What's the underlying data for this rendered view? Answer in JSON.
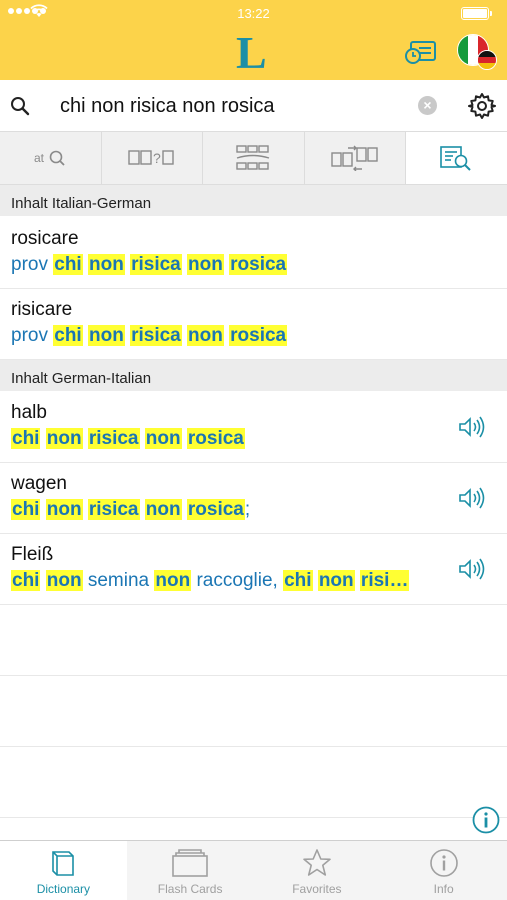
{
  "status_bar": {
    "time": "13:22",
    "battery_level": 1.0
  },
  "nav": {
    "logo_letter": "L",
    "source_language": "Italian",
    "target_language": "German"
  },
  "search": {
    "query": "chi non risica non rosica"
  },
  "mode_tabs": [
    {
      "icon": "text-search-icon",
      "label": "at"
    },
    {
      "icon": "fill-in-blank-icon",
      "label": "?"
    },
    {
      "icon": "conjugation-table-icon",
      "label": ""
    },
    {
      "icon": "phrase-compare-icon",
      "label": ""
    },
    {
      "icon": "full-text-search-icon",
      "label": "",
      "active": true
    }
  ],
  "sections": [
    {
      "title": "Inhalt Italian-German",
      "entries": [
        {
          "headword": "rosicare",
          "prefix": "prov",
          "translation": [
            "chi",
            "non",
            "risica",
            "non",
            "rosica"
          ],
          "suffix": "",
          "has_audio": false
        },
        {
          "headword": "risicare",
          "prefix": "prov",
          "translation": [
            "chi",
            "non",
            "risica",
            "non",
            "rosica"
          ],
          "suffix": "",
          "has_audio": false
        }
      ]
    },
    {
      "title": "Inhalt German-Italian",
      "entries": [
        {
          "headword": "halb",
          "prefix": "",
          "translation": [
            "chi",
            "non",
            "risica",
            "non",
            "rosica"
          ],
          "suffix": "",
          "has_audio": true
        },
        {
          "headword": "wagen",
          "prefix": "",
          "translation": [
            "chi",
            "non",
            "risica",
            "non",
            "rosica"
          ],
          "suffix": ";",
          "has_audio": true
        },
        {
          "headword": "Fleiß",
          "prefix": "",
          "translation_mixed": [
            {
              "t": "chi",
              "hl": true
            },
            {
              "t": " ",
              "hl": false
            },
            {
              "t": "non",
              "hl": true
            },
            {
              "t": " semina ",
              "hl": false
            },
            {
              "t": "non",
              "hl": true
            },
            {
              "t": " raccoglie, ",
              "hl": false
            },
            {
              "t": "chi",
              "hl": true
            },
            {
              "t": " ",
              "hl": false
            },
            {
              "t": "non",
              "hl": true
            },
            {
              "t": " ",
              "hl": false
            },
            {
              "t": "risi…",
              "hl": true
            }
          ],
          "has_audio": true
        }
      ]
    }
  ],
  "tabbar": [
    {
      "label": "Dictionary",
      "icon": "book-icon",
      "active": true
    },
    {
      "label": "Flash Cards",
      "icon": "flash-cards-icon",
      "active": false
    },
    {
      "label": "Favorites",
      "icon": "star-icon",
      "active": false
    },
    {
      "label": "Info",
      "icon": "info-icon",
      "active": false
    }
  ],
  "colors": {
    "brand_yellow": "#fcd34a",
    "brand_teal": "#1b8fa6",
    "link_blue": "#1b76b4",
    "highlight": "#ffff33"
  }
}
